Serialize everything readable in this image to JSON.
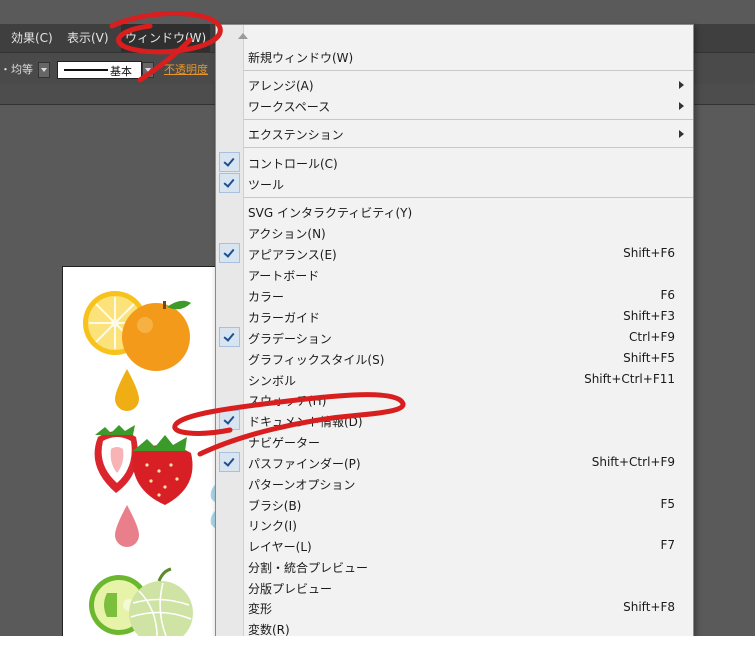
{
  "menubar": {
    "items": [
      "効果(C)",
      "表示(V)",
      "ウィンドウ(W)"
    ]
  },
  "controlbar": {
    "uniform_label": "・均等",
    "stroke_style_label": "基本",
    "opacity_link": "不透明度"
  },
  "window_menu": {
    "items": [
      {
        "label": "新規ウィンドウ(W)",
        "shortcut": "",
        "checked": false,
        "submenu": false
      },
      {
        "label": "アレンジ(A)",
        "shortcut": "",
        "checked": false,
        "submenu": true
      },
      {
        "label": "ワークスペース",
        "shortcut": "",
        "checked": false,
        "submenu": true
      },
      {
        "label": "エクステンション",
        "shortcut": "",
        "checked": false,
        "submenu": true
      },
      {
        "label": "コントロール(C)",
        "shortcut": "",
        "checked": true,
        "submenu": false
      },
      {
        "label": "ツール",
        "shortcut": "",
        "checked": true,
        "submenu": false
      },
      {
        "label": "SVG インタラクティビティ(Y)",
        "shortcut": "",
        "checked": false,
        "submenu": false
      },
      {
        "label": "アクション(N)",
        "shortcut": "",
        "checked": false,
        "submenu": false
      },
      {
        "label": "アピアランス(E)",
        "shortcut": "Shift+F6",
        "checked": true,
        "submenu": false
      },
      {
        "label": "アートボード",
        "shortcut": "",
        "checked": false,
        "submenu": false
      },
      {
        "label": "カラー",
        "shortcut": "F6",
        "checked": false,
        "submenu": false
      },
      {
        "label": "カラーガイド",
        "shortcut": "Shift+F3",
        "checked": false,
        "submenu": false
      },
      {
        "label": "グラデーション",
        "shortcut": "Ctrl+F9",
        "checked": true,
        "submenu": false
      },
      {
        "label": "グラフィックスタイル(S)",
        "shortcut": "Shift+F5",
        "checked": false,
        "submenu": false
      },
      {
        "label": "シンボル",
        "shortcut": "Shift+Ctrl+F11",
        "checked": false,
        "submenu": false
      },
      {
        "label": "スウォッチ(H)",
        "shortcut": "",
        "checked": false,
        "submenu": false
      },
      {
        "label": "ドキュメント情報(D)",
        "shortcut": "",
        "checked": true,
        "submenu": false
      },
      {
        "label": "ナビゲーター",
        "shortcut": "",
        "checked": false,
        "submenu": false
      },
      {
        "label": "パスファインダー(P)",
        "shortcut": "Shift+Ctrl+F9",
        "checked": true,
        "submenu": false
      },
      {
        "label": "パターンオプション",
        "shortcut": "",
        "checked": false,
        "submenu": false
      },
      {
        "label": "ブラシ(B)",
        "shortcut": "F5",
        "checked": false,
        "submenu": false
      },
      {
        "label": "リンク(I)",
        "shortcut": "",
        "checked": false,
        "submenu": false
      },
      {
        "label": "レイヤー(L)",
        "shortcut": "F7",
        "checked": false,
        "submenu": false
      },
      {
        "label": "分割・統合プレビュー",
        "shortcut": "",
        "checked": false,
        "submenu": false
      },
      {
        "label": "分版プレビュー",
        "shortcut": "",
        "checked": false,
        "submenu": false
      },
      {
        "label": "変形",
        "shortcut": "Shift+F8",
        "checked": false,
        "submenu": false
      },
      {
        "label": "変数(R)",
        "shortcut": "",
        "checked": false,
        "submenu": false
      }
    ]
  },
  "colors": {
    "app_background": "#5a5a5a",
    "menubar": "#3f3f3f",
    "menu_background": "#f2f2f2",
    "annotation_red": "#d81e1e",
    "opacity_link": "#e8962a"
  }
}
